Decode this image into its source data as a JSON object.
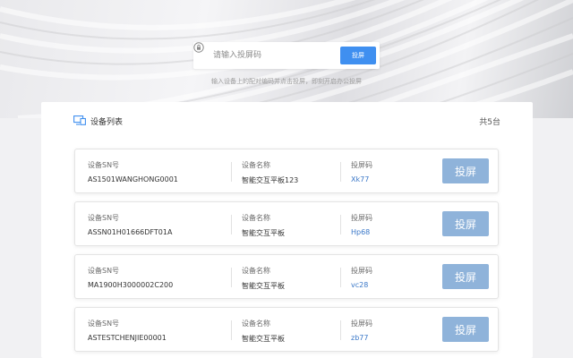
{
  "search": {
    "placeholder": "请输入投屏码",
    "button_label": "投屏",
    "hint": "输入设备上的配对编码并点击投屏，即刻开启办公投屏"
  },
  "panel": {
    "title": "设备列表",
    "count": "共5台"
  },
  "labels": {
    "sn": "设备SN号",
    "name": "设备名称",
    "code": "投屏码",
    "cast_button": "投屏"
  },
  "devices": [
    {
      "sn": "AS1501WANGHONG0001",
      "name": "智能交互平板123",
      "code": "Xk77"
    },
    {
      "sn": "ASSN01H01666DFT01A",
      "name": "智能交互平板",
      "code": "Hp68"
    },
    {
      "sn": "MA1900H3000002C200",
      "name": "智能交互平板",
      "code": "vc28"
    },
    {
      "sn": "ASTESTCHENJIE00001",
      "name": "智能交互平板",
      "code": "zb77"
    }
  ],
  "colors": {
    "accent": "#3f8ff0",
    "cast_button": "#8fb3da",
    "code_text": "#3b78c8"
  },
  "icons": {
    "search": "lock-icon",
    "list": "monitor-icon"
  }
}
